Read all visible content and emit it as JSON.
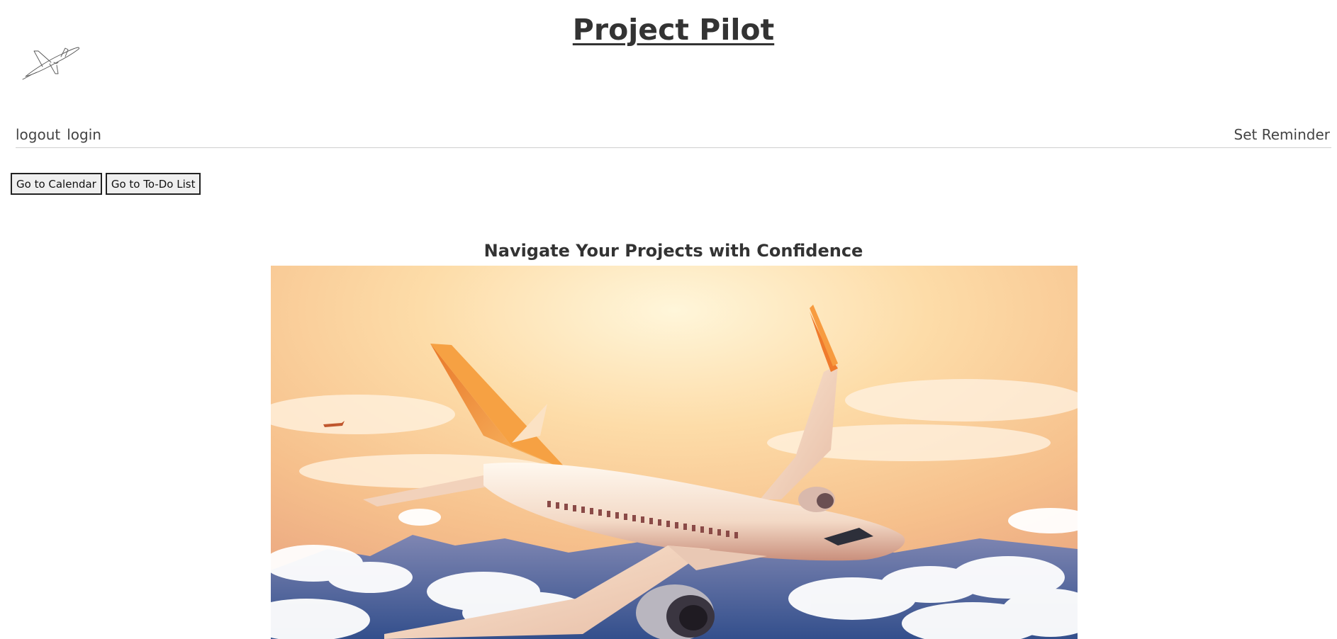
{
  "header": {
    "site_title": "Project Pilot",
    "logo_icon": "airplane-sketch-icon"
  },
  "nav": {
    "logout_label": "logout",
    "login_label": "login",
    "reminder_label": "Set Reminder"
  },
  "actions": {
    "calendar_label": "Go to Calendar",
    "todo_label": "Go to To-Do List"
  },
  "hero": {
    "tagline": "Navigate Your Projects with Confidence",
    "image_icon": "airplane-photo"
  },
  "colors": {
    "text": "#333333",
    "sky_top": "#fbbf7a",
    "sky_glow": "#fff4d6",
    "cloud": "#ffffff",
    "mountain": "#5a6fa0",
    "tail": "#f59a3c"
  }
}
